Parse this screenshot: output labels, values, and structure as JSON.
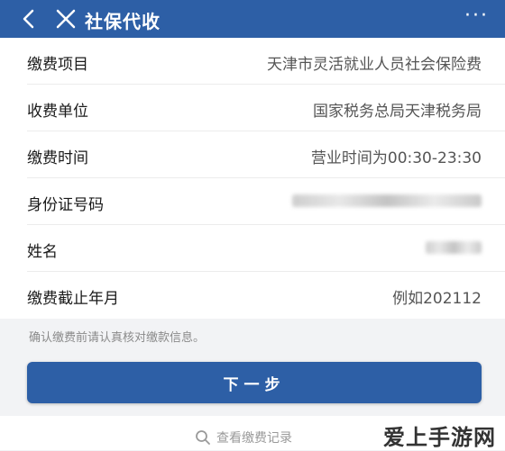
{
  "header": {
    "title": "社保代收",
    "more": "···",
    "color": "#2d5fa6"
  },
  "form": {
    "rows": [
      {
        "label": "缴费项目",
        "value": "天津市灵活就业人员社会保险费"
      },
      {
        "label": "收费单位",
        "value": "国家税务总局天津税务局"
      },
      {
        "label": "缴费时间",
        "value": "营业时间为00:30-23:30"
      },
      {
        "label": "身份证号码",
        "value": ""
      },
      {
        "label": "姓名",
        "value": ""
      },
      {
        "label": "缴费截止年月",
        "value": "例如202112"
      }
    ]
  },
  "notice": "确认缴费前请认真核对缴款信息。",
  "next_button": "下一步",
  "records_link": "查看缴费记录",
  "watermark": "爱上手游网",
  "icons": [
    "back-arrow-icon",
    "close-icon",
    "more-icon",
    "search-icon"
  ]
}
